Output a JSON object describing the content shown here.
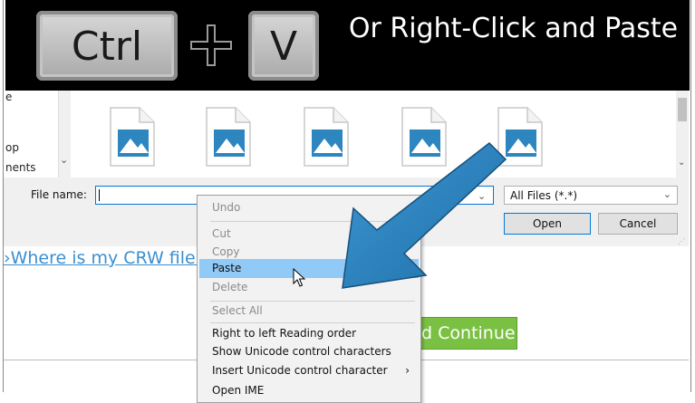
{
  "banner": {
    "key1": "Ctrl",
    "key2": "V",
    "text": "Or Right-Click and Paste"
  },
  "nav_pane": {
    "items": [
      "e",
      "op",
      "nents"
    ]
  },
  "file_dialog": {
    "file_name_label": "File name:",
    "file_name_value": "",
    "filter_value": "All Files (*.*)",
    "open_label": "Open",
    "cancel_label": "Cancel"
  },
  "page": {
    "crw_link": "›Where is my CRW file?",
    "continue_button": "nd Continue"
  },
  "context_menu": {
    "items": [
      {
        "label": "Undo",
        "enabled": false
      },
      {
        "label": "Cut",
        "enabled": false
      },
      {
        "label": "Copy",
        "enabled": false
      },
      {
        "label": "Paste",
        "enabled": true,
        "highlighted": true
      },
      {
        "label": "Delete",
        "enabled": false
      },
      {
        "label": "Select All",
        "enabled": false
      },
      {
        "label": "Right to left Reading order",
        "enabled": true
      },
      {
        "label": "Show Unicode control characters",
        "enabled": true
      },
      {
        "label": "Insert Unicode control character",
        "enabled": true,
        "submenu": true
      },
      {
        "label": "Open IME",
        "enabled": true
      }
    ]
  },
  "colors": {
    "arrow": "#2e86c1",
    "highlight": "#91c9f7",
    "link": "#3b8fd0",
    "continue_bg": "#7ac143",
    "file_icon": "#2e86c1"
  },
  "icons": [
    "image-file-icon",
    "mouse-pointer-icon",
    "plus-icon",
    "chevron-down-icon",
    "chevron-right-icon"
  ]
}
